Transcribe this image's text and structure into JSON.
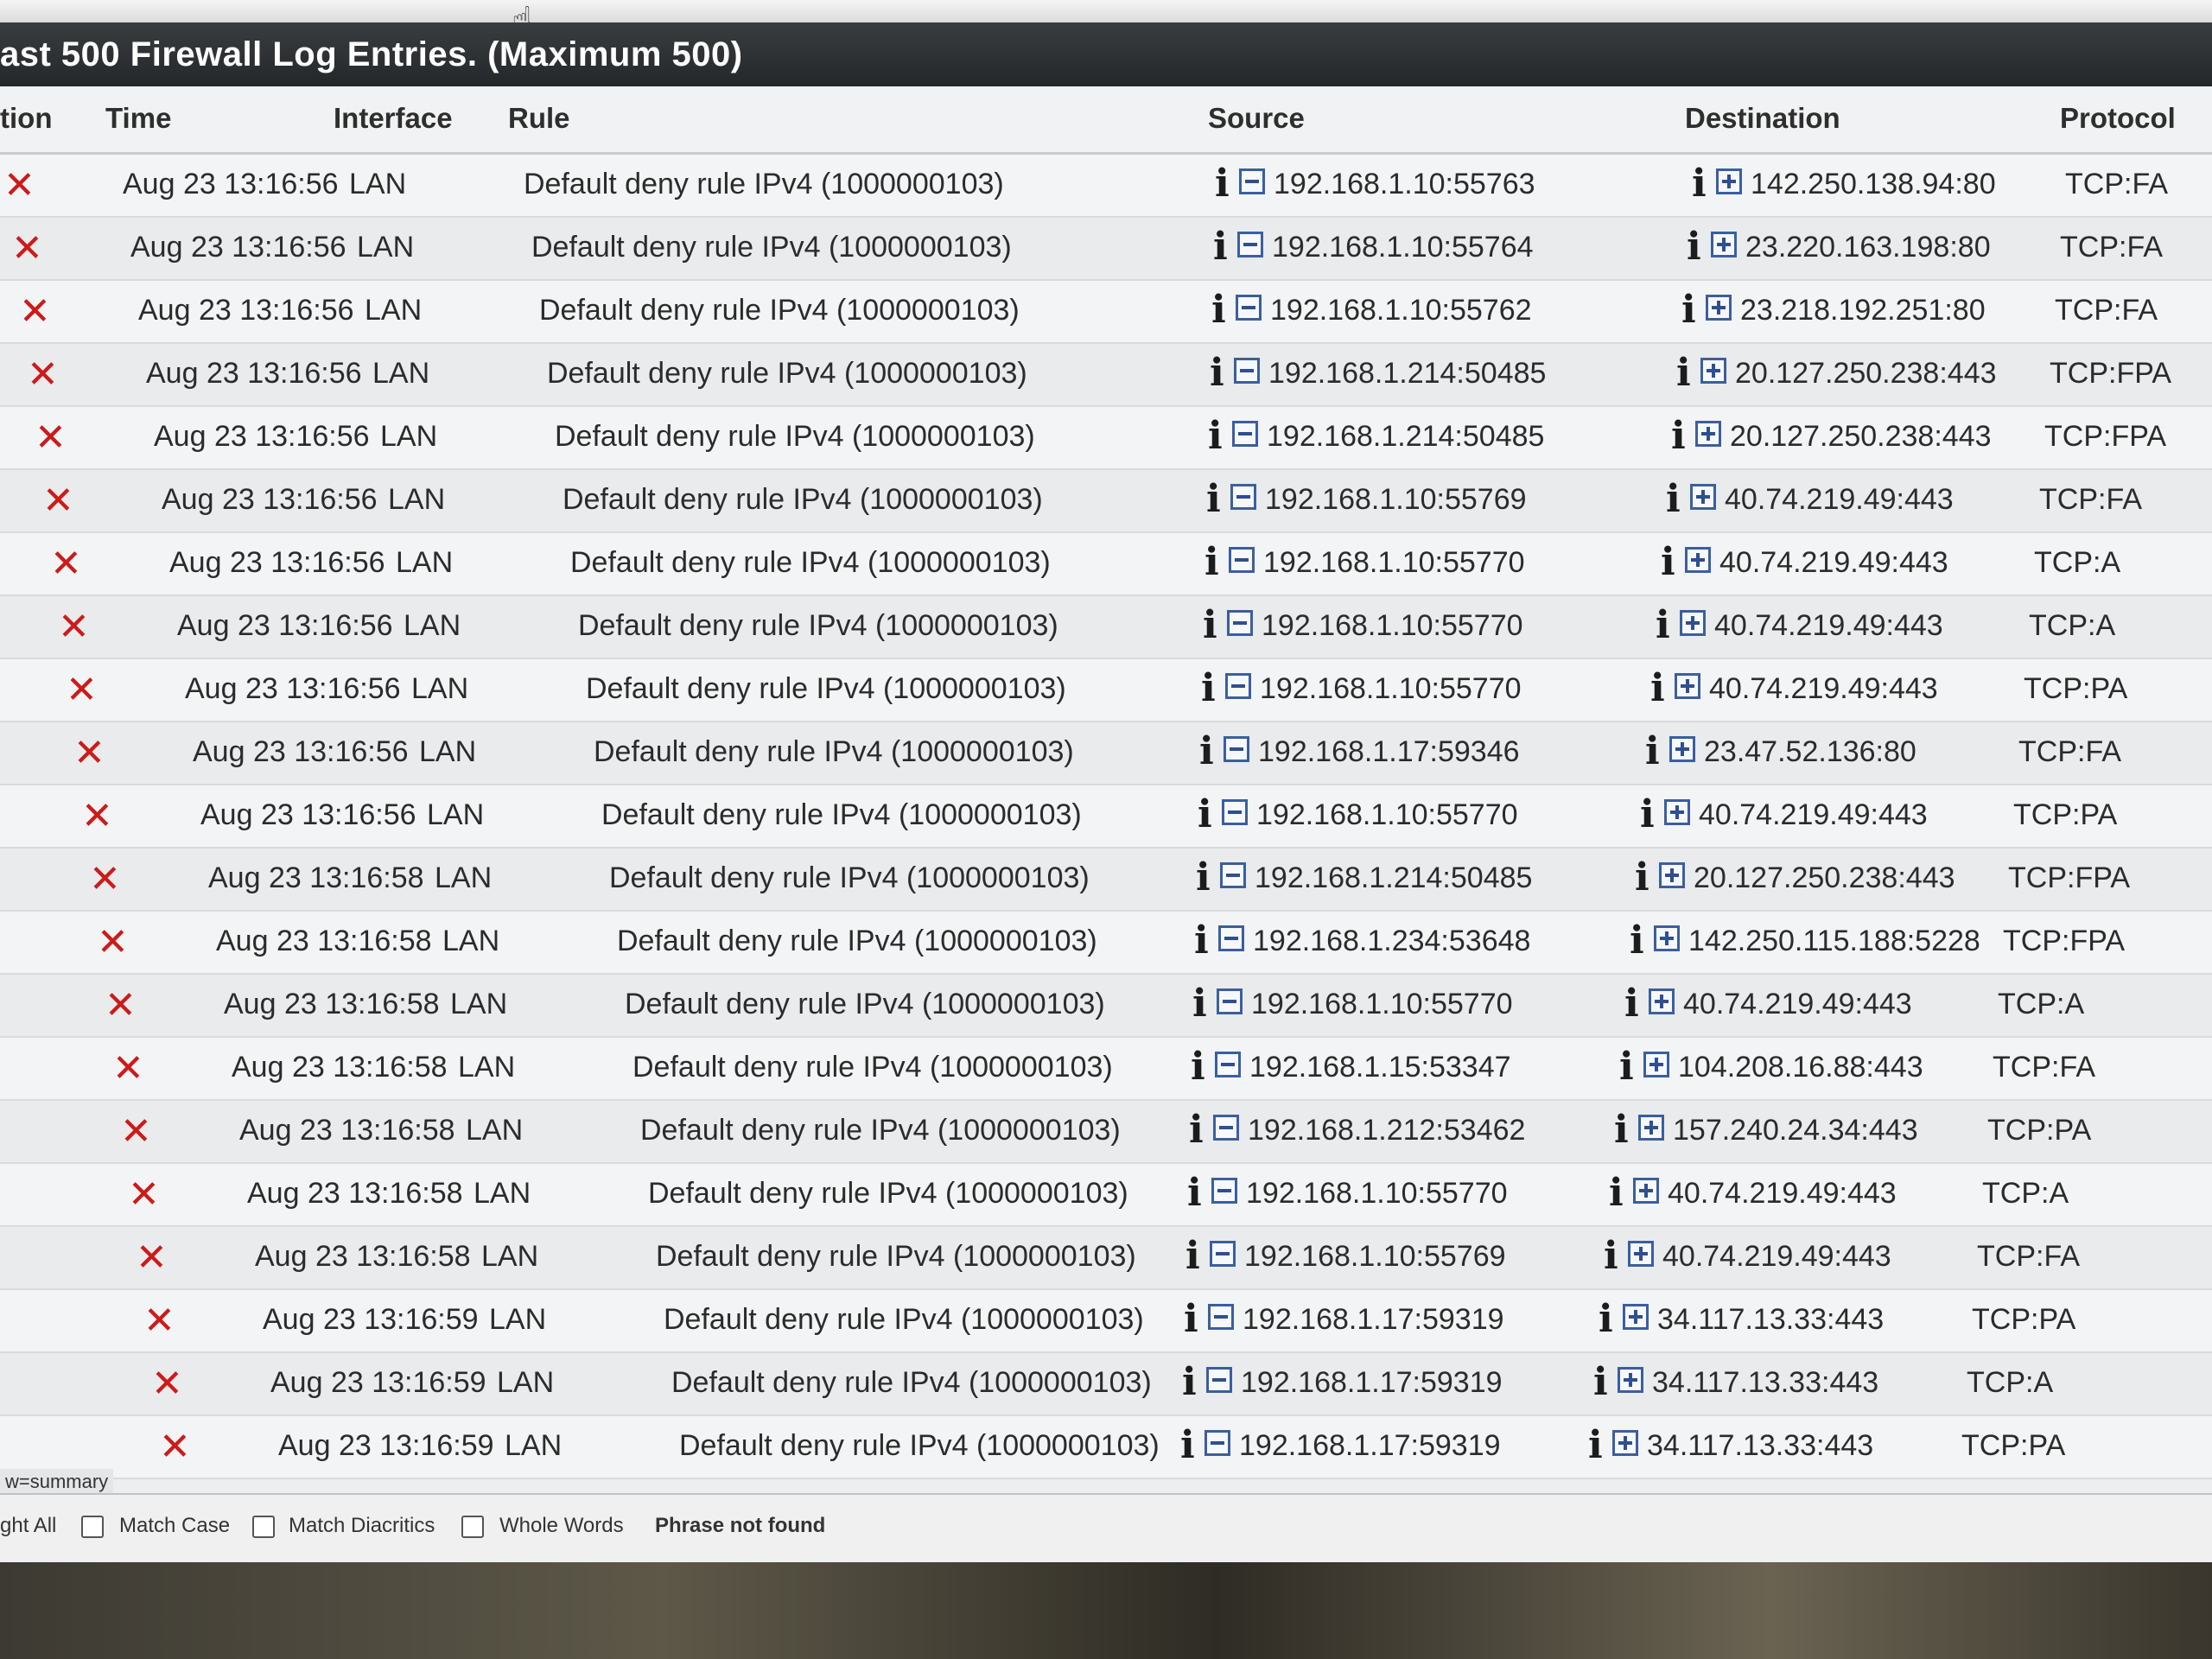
{
  "panel": {
    "title": "ast 500 Firewall Log Entries. (Maximum 500)"
  },
  "columns": {
    "action": "tion",
    "time": "Time",
    "interface": "Interface",
    "rule": "Rule",
    "source": "Source",
    "destination": "Destination",
    "protocol": "Protocol"
  },
  "icons": {
    "action": "block-x-icon",
    "info": "info-icon",
    "source_toggle": "collapse-minus-icon",
    "destination_toggle": "expand-plus-icon"
  },
  "colors": {
    "block": "#cc1b1b",
    "header_bg": "#2b2e31",
    "toggle_border": "#3b5f9e"
  },
  "rows": [
    {
      "action": "✕",
      "time": "Aug 23 13:16:56",
      "interface": "LAN",
      "rule": "Default deny rule IPv4 (1000000103)",
      "source": "192.168.1.10:55763",
      "destination": "142.250.138.94:80",
      "protocol": "TCP:FA"
    },
    {
      "action": "✕",
      "time": "Aug 23 13:16:56",
      "interface": "LAN",
      "rule": "Default deny rule IPv4 (1000000103)",
      "source": "192.168.1.10:55764",
      "destination": "23.220.163.198:80",
      "protocol": "TCP:FA"
    },
    {
      "action": "✕",
      "time": "Aug 23 13:16:56",
      "interface": "LAN",
      "rule": "Default deny rule IPv4 (1000000103)",
      "source": "192.168.1.10:55762",
      "destination": "23.218.192.251:80",
      "protocol": "TCP:FA"
    },
    {
      "action": "✕",
      "time": "Aug 23 13:16:56",
      "interface": "LAN",
      "rule": "Default deny rule IPv4 (1000000103)",
      "source": "192.168.1.214:50485",
      "destination": "20.127.250.238:443",
      "protocol": "TCP:FPA"
    },
    {
      "action": "✕",
      "time": "Aug 23 13:16:56",
      "interface": "LAN",
      "rule": "Default deny rule IPv4 (1000000103)",
      "source": "192.168.1.214:50485",
      "destination": "20.127.250.238:443",
      "protocol": "TCP:FPA"
    },
    {
      "action": "✕",
      "time": "Aug 23 13:16:56",
      "interface": "LAN",
      "rule": "Default deny rule IPv4 (1000000103)",
      "source": "192.168.1.10:55769",
      "destination": "40.74.219.49:443",
      "protocol": "TCP:FA"
    },
    {
      "action": "✕",
      "time": "Aug 23 13:16:56",
      "interface": "LAN",
      "rule": "Default deny rule IPv4 (1000000103)",
      "source": "192.168.1.10:55770",
      "destination": "40.74.219.49:443",
      "protocol": "TCP:A"
    },
    {
      "action": "✕",
      "time": "Aug 23 13:16:56",
      "interface": "LAN",
      "rule": "Default deny rule IPv4 (1000000103)",
      "source": "192.168.1.10:55770",
      "destination": "40.74.219.49:443",
      "protocol": "TCP:A"
    },
    {
      "action": "✕",
      "time": "Aug 23 13:16:56",
      "interface": "LAN",
      "rule": "Default deny rule IPv4 (1000000103)",
      "source": "192.168.1.10:55770",
      "destination": "40.74.219.49:443",
      "protocol": "TCP:PA"
    },
    {
      "action": "✕",
      "time": "Aug 23 13:16:56",
      "interface": "LAN",
      "rule": "Default deny rule IPv4 (1000000103)",
      "source": "192.168.1.17:59346",
      "destination": "23.47.52.136:80",
      "protocol": "TCP:FA"
    },
    {
      "action": "✕",
      "time": "Aug 23 13:16:56",
      "interface": "LAN",
      "rule": "Default deny rule IPv4 (1000000103)",
      "source": "192.168.1.10:55770",
      "destination": "40.74.219.49:443",
      "protocol": "TCP:PA"
    },
    {
      "action": "✕",
      "time": "Aug 23 13:16:58",
      "interface": "LAN",
      "rule": "Default deny rule IPv4 (1000000103)",
      "source": "192.168.1.214:50485",
      "destination": "20.127.250.238:443",
      "protocol": "TCP:FPA"
    },
    {
      "action": "✕",
      "time": "Aug 23 13:16:58",
      "interface": "LAN",
      "rule": "Default deny rule IPv4 (1000000103)",
      "source": "192.168.1.234:53648",
      "destination": "142.250.115.188:5228",
      "protocol": "TCP:FPA"
    },
    {
      "action": "✕",
      "time": "Aug 23 13:16:58",
      "interface": "LAN",
      "rule": "Default deny rule IPv4 (1000000103)",
      "source": "192.168.1.10:55770",
      "destination": "40.74.219.49:443",
      "protocol": "TCP:A"
    },
    {
      "action": "✕",
      "time": "Aug 23 13:16:58",
      "interface": "LAN",
      "rule": "Default deny rule IPv4 (1000000103)",
      "source": "192.168.1.15:53347",
      "destination": "104.208.16.88:443",
      "protocol": "TCP:FA"
    },
    {
      "action": "✕",
      "time": "Aug 23 13:16:58",
      "interface": "LAN",
      "rule": "Default deny rule IPv4 (1000000103)",
      "source": "192.168.1.212:53462",
      "destination": "157.240.24.34:443",
      "protocol": "TCP:PA"
    },
    {
      "action": "✕",
      "time": "Aug 23 13:16:58",
      "interface": "LAN",
      "rule": "Default deny rule IPv4 (1000000103)",
      "source": "192.168.1.10:55770",
      "destination": "40.74.219.49:443",
      "protocol": "TCP:A"
    },
    {
      "action": "✕",
      "time": "Aug 23 13:16:58",
      "interface": "LAN",
      "rule": "Default deny rule IPv4 (1000000103)",
      "source": "192.168.1.10:55769",
      "destination": "40.74.219.49:443",
      "protocol": "TCP:FA"
    },
    {
      "action": "✕",
      "time": "Aug 23 13:16:59",
      "interface": "LAN",
      "rule": "Default deny rule IPv4 (1000000103)",
      "source": "192.168.1.17:59319",
      "destination": "34.117.13.33:443",
      "protocol": "TCP:PA"
    },
    {
      "action": "✕",
      "time": "Aug 23 13:16:59",
      "interface": "LAN",
      "rule": "Default deny rule IPv4 (1000000103)",
      "source": "192.168.1.17:59319",
      "destination": "34.117.13.33:443",
      "protocol": "TCP:A"
    },
    {
      "action": "✕",
      "time": "Aug 23 13:16:59",
      "interface": "LAN",
      "rule": "Default deny rule IPv4 (1000000103)",
      "source": "192.168.1.17:59319",
      "destination": "34.117.13.33:443",
      "protocol": "TCP:PA"
    }
  ],
  "summary_label": "w=summary",
  "findbar": {
    "highlight_all": "ght All",
    "match_case": "Match Case",
    "match_diacritics": "Match Diacritics",
    "whole_words": "Whole Words",
    "status": "Phrase not found"
  }
}
